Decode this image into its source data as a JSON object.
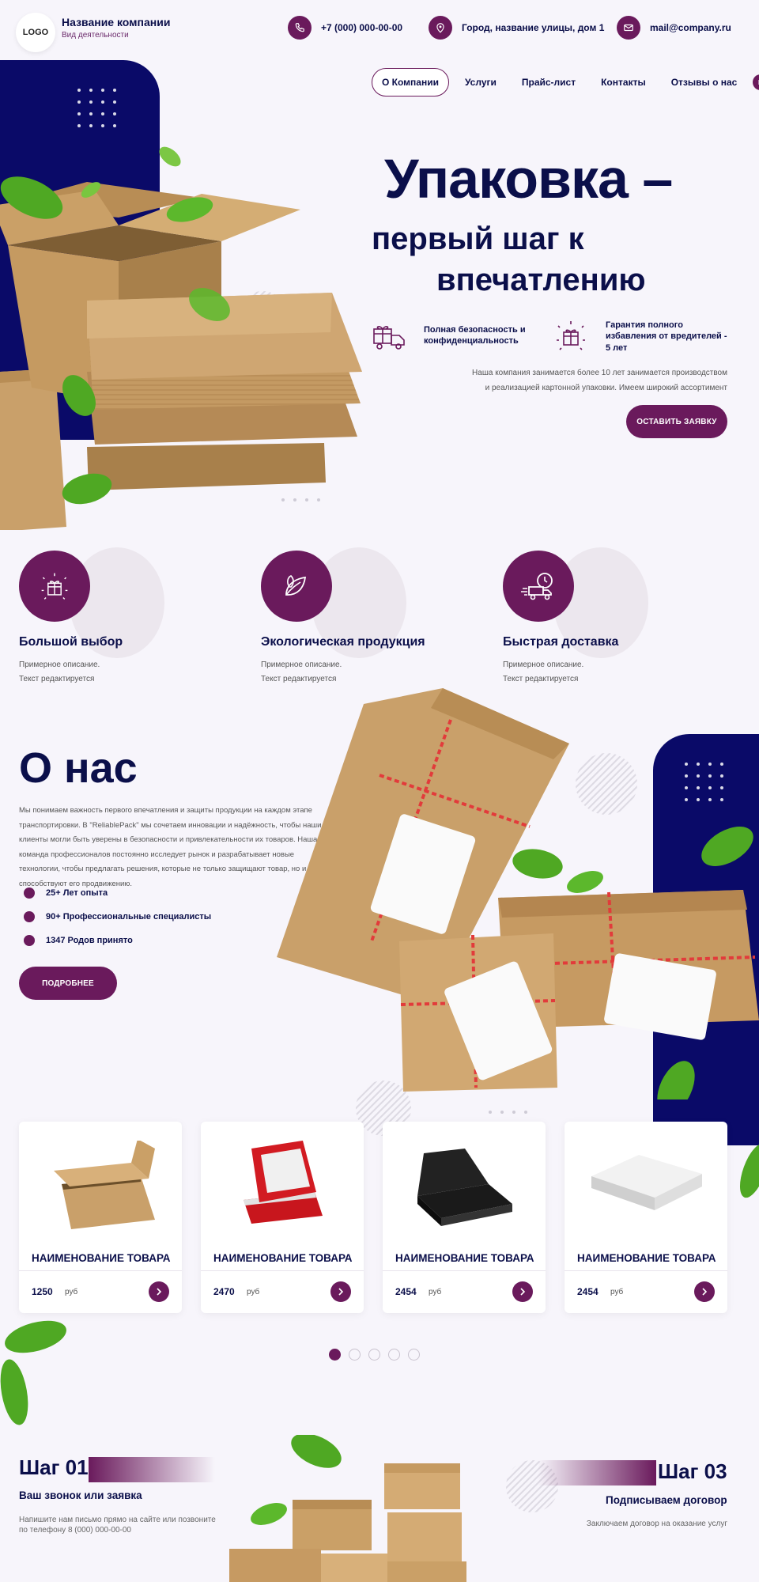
{
  "header": {
    "logo": "LOGO",
    "company_name": "Название компании",
    "company_activity": "Вид деятельности",
    "phone": "+7 (000) 000-00-00",
    "address": "Город, название улицы, дом 1",
    "email": "mail@company.ru"
  },
  "nav": {
    "items": [
      "О Компании",
      "Услуги",
      "Прайс-лист",
      "Контакты",
      "Отзывы о нас"
    ],
    "active_index": 0
  },
  "hero": {
    "title_line1": "Упаковка –",
    "title_line2": "первый шаг к",
    "title_line3": "впечатлению",
    "feature1": "Полная безопасность и конфиденциальность",
    "feature2": "Гарантия полного избавления от вредителей - 5 лет",
    "description": "Наша компания занимается более 10 лет занимается производством и реализацией картонной упаковки. Имеем широкий ассортимент",
    "cta": "ОСТАВИТЬ ЗАЯВКУ"
  },
  "features": [
    {
      "title": "Большой выбор",
      "desc1": "Примерное описание.",
      "desc2": "Текст редактируется",
      "icon": "gift-sparkle-icon"
    },
    {
      "title": "Экологическая продукция",
      "desc1": "Примерное описание.",
      "desc2": "Текст редактируется",
      "icon": "leaves-icon"
    },
    {
      "title": "Быстрая доставка",
      "desc1": "Примерное описание.",
      "desc2": "Текст редактируется",
      "icon": "delivery-truck-clock-icon"
    }
  ],
  "about": {
    "title": "О нас",
    "text": "Мы понимаем важность первого впечатления и защиты продукции на каждом этапе транспортировки. В \"ReliablePack\" мы сочетаем инновации и надёжность, чтобы наши клиенты могли быть уверены в безопасности и привлекательности их товаров. Наша команда профессионалов постоянно исследует рынок и разрабатывает новые технологии, чтобы предлагать решения, которые не только защищают товар, но и способствуют его продвижению.",
    "bullets": [
      "25+ Лет опыта",
      "90+ Профессиональные специалисты",
      "1347 Родов принято"
    ],
    "button": "ПОДРОБНЕЕ"
  },
  "products": [
    {
      "name": "НАИМЕНОВАНИЕ ТОВАРА",
      "price": "1250",
      "currency": "руб",
      "image": "open-cardboard-box"
    },
    {
      "name": "НАИМЕНОВАНИЕ ТОВАРА",
      "price": "2470",
      "currency": "руб",
      "image": "red-ring-box"
    },
    {
      "name": "НАИМЕНОВАНИЕ ТОВАРА",
      "price": "2454",
      "currency": "руб",
      "image": "black-magnetic-box"
    },
    {
      "name": "НАИМЕНОВАНИЕ ТОВАРА",
      "price": "2454",
      "currency": "руб",
      "image": "white-pizza-box"
    }
  ],
  "pager": {
    "count": 5,
    "active": 0
  },
  "steps": [
    {
      "title": "Шаг 01",
      "subtitle": "Ваш звонок или заявка",
      "desc": "Напишите нам письмо прямо на сайте или позвоните по телефону 8 (000) 000-00-00"
    },
    {
      "title": "Шаг 03",
      "subtitle": "Подписываем договор",
      "desc": "Заключаем договор на оказание услуг"
    }
  ],
  "colors": {
    "navy": "#0a0a68",
    "accent": "#6a1a5c",
    "title": "#0b0f4a",
    "background": "#f7f5fb",
    "kraft": "#c9a06a",
    "leaf": "#4fa823"
  }
}
